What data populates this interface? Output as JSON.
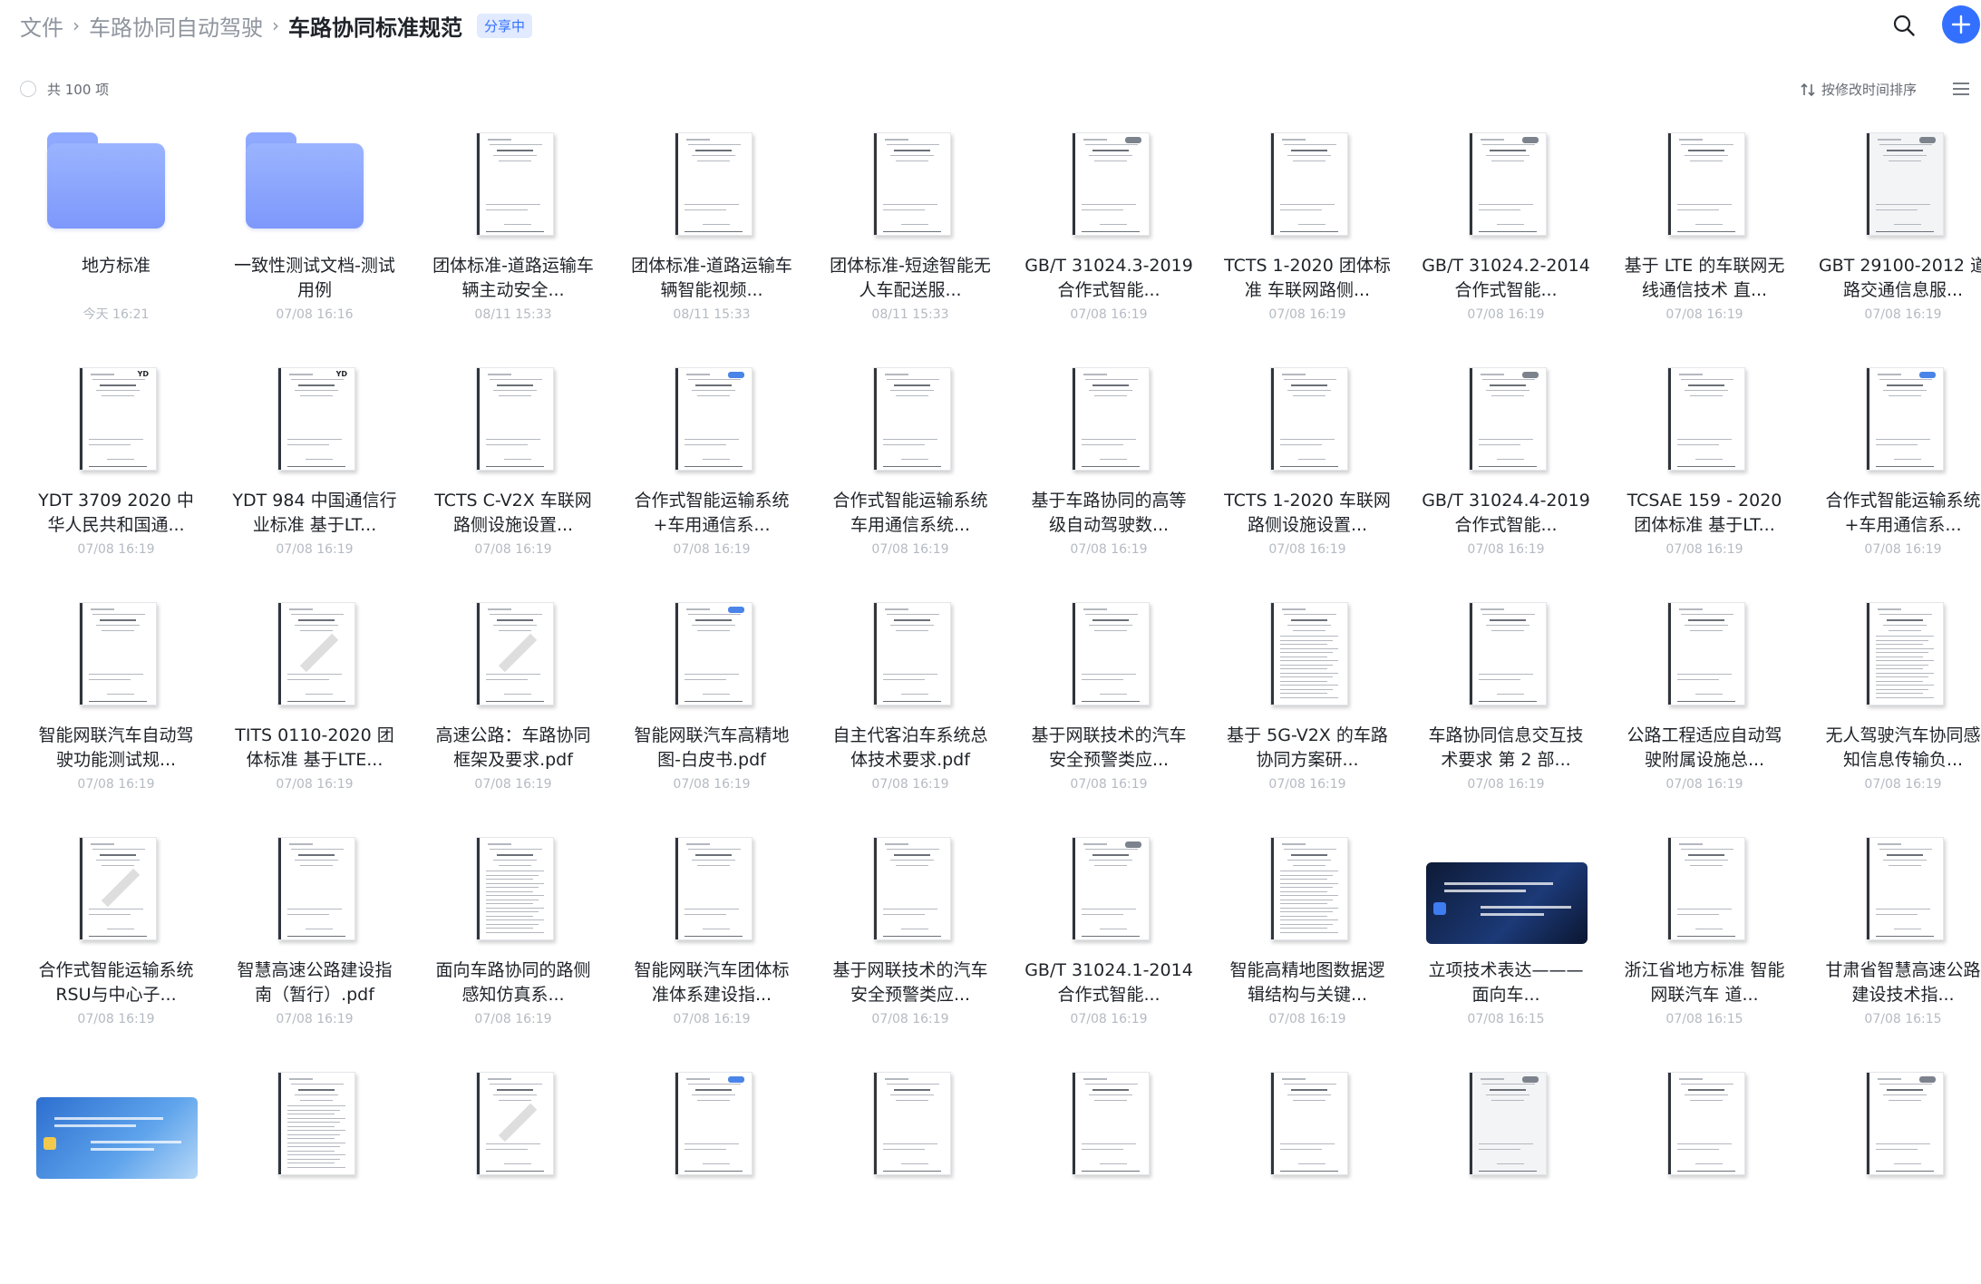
{
  "breadcrumb": {
    "root": "文件",
    "parent": "车路协同自动驾驶",
    "current": "车路协同标准规范",
    "badge": "分享中",
    "separator": "›"
  },
  "toolbar": {
    "search_icon": "search-icon",
    "add_icon": "plus-icon"
  },
  "list_header": {
    "count": "共 100 项",
    "sort_label": "按修改时间排序",
    "sort_icon": "sort-arrows-icon",
    "view_icon": "list-view-icon"
  },
  "colors": {
    "accent": "#3370ff",
    "folder": "#8ea9ff",
    "muted_text": "#8f959e"
  },
  "items": [
    {
      "kind": "folder",
      "title": "地方标准",
      "time": "今天 16:21"
    },
    {
      "kind": "folder",
      "title": "一致性测试文档-测试用例",
      "time": "07/08 16:16"
    },
    {
      "kind": "doc",
      "variant": "plain",
      "title": "团体标准-道路运输车辆主动安全...",
      "time": "08/11 15:33"
    },
    {
      "kind": "doc",
      "variant": "plain",
      "title": "团体标准-道路运输车辆智能视频...",
      "time": "08/11 15:33"
    },
    {
      "kind": "doc",
      "variant": "plain",
      "title": "团体标准-短途智能无人车配送服...",
      "time": "08/11 15:33"
    },
    {
      "kind": "doc",
      "variant": "gb",
      "title": "GB/T 31024.3-2019 合作式智能...",
      "time": "07/08 16:19"
    },
    {
      "kind": "doc",
      "variant": "plain",
      "title": "TCTS 1-2020 团体标准 车联网路侧...",
      "time": "07/08 16:19"
    },
    {
      "kind": "doc",
      "variant": "gb",
      "title": "GB/T 31024.2-2014 合作式智能...",
      "time": "07/08 16:19"
    },
    {
      "kind": "doc",
      "variant": "plain",
      "title": "基于 LTE 的车联网无线通信技术 直...",
      "time": "07/08 16:19"
    },
    {
      "kind": "doc",
      "variant": "grey",
      "title": "GBT 29100-2012 道路交通信息服...",
      "time": "07/08 16:19"
    },
    {
      "kind": "doc",
      "variant": "yd",
      "title": "YDT 3709 2020 中华人民共和国通...",
      "time": "07/08 16:19"
    },
    {
      "kind": "doc",
      "variant": "yd",
      "title": "YDT 984 中国通信行业标准 基于LT...",
      "time": "07/08 16:19"
    },
    {
      "kind": "doc",
      "variant": "plain",
      "title": "TCTS C-V2X 车联网路侧设施设置...",
      "time": "07/08 16:19"
    },
    {
      "kind": "doc",
      "variant": "blue",
      "title": "合作式智能运输系统+车用通信系...",
      "time": "07/08 16:19"
    },
    {
      "kind": "doc",
      "variant": "plain",
      "title": "合作式智能运输系统 车用通信系统...",
      "time": "07/08 16:19"
    },
    {
      "kind": "doc",
      "variant": "plain",
      "title": "基于车路协同的高等级自动驾驶数...",
      "time": "07/08 16:19"
    },
    {
      "kind": "doc",
      "variant": "plain",
      "title": "TCTS 1-2020 车联网路侧设施设置...",
      "time": "07/08 16:19"
    },
    {
      "kind": "doc",
      "variant": "gb",
      "title": "GB/T 31024.4-2019 合作式智能...",
      "time": "07/08 16:19"
    },
    {
      "kind": "doc",
      "variant": "plain",
      "title": "TCSAE 159 - 2020 团体标准 基于LT...",
      "time": "07/08 16:19"
    },
    {
      "kind": "doc",
      "variant": "blue",
      "title": "合作式智能运输系统+车用通信系...",
      "time": "07/08 16:19"
    },
    {
      "kind": "doc",
      "variant": "plain",
      "title": "智能网联汽车自动驾驶功能测试规...",
      "time": "07/08 16:19"
    },
    {
      "kind": "doc",
      "variant": "stamp",
      "title": "TITS 0110-2020 团体标准 基于LTE...",
      "time": "07/08 16:19"
    },
    {
      "kind": "doc",
      "variant": "stamp",
      "title": "高速公路：车路协同框架及要求.pdf",
      "time": "07/08 16:19"
    },
    {
      "kind": "doc",
      "variant": "blue",
      "title": "智能网联汽车高精地图-白皮书.pdf",
      "time": "07/08 16:19"
    },
    {
      "kind": "doc",
      "variant": "plain",
      "title": "自主代客泊车系统总体技术要求.pdf",
      "time": "07/08 16:19"
    },
    {
      "kind": "doc",
      "variant": "plain",
      "title": "基于网联技术的汽车安全预警类应...",
      "time": "07/08 16:19"
    },
    {
      "kind": "doc",
      "variant": "dense",
      "title": "基于 5G-V2X 的车路协同方案研...",
      "time": "07/08 16:19"
    },
    {
      "kind": "doc",
      "variant": "plain",
      "title": "车路协同信息交互技术要求 第 2 部...",
      "time": "07/08 16:19"
    },
    {
      "kind": "doc",
      "variant": "plain",
      "title": "公路工程适应自动驾驶附属设施总...",
      "time": "07/08 16:19"
    },
    {
      "kind": "doc",
      "variant": "dense",
      "title": "无人驾驶汽车协同感知信息传输负...",
      "time": "07/08 16:19"
    },
    {
      "kind": "doc",
      "variant": "stamp",
      "title": "合作式智能运输系统 RSU与中心子...",
      "time": "07/08 16:19"
    },
    {
      "kind": "doc",
      "variant": "plain",
      "title": "智慧高速公路建设指南（暂行）.pdf",
      "time": "07/08 16:19"
    },
    {
      "kind": "doc",
      "variant": "dense",
      "title": "面向车路协同的路侧感知仿真系...",
      "time": "07/08 16:19"
    },
    {
      "kind": "doc",
      "variant": "plain",
      "title": "智能网联汽车团体标准体系建设指...",
      "time": "07/08 16:19"
    },
    {
      "kind": "doc",
      "variant": "plain",
      "title": "基于网联技术的汽车安全预警类应...",
      "time": "07/08 16:19"
    },
    {
      "kind": "doc",
      "variant": "gb",
      "title": "GB/T 31024.1-2014 合作式智能...",
      "time": "07/08 16:19"
    },
    {
      "kind": "doc",
      "variant": "dense",
      "title": "智能高精地图数据逻辑结构与关键...",
      "time": "07/08 16:19"
    },
    {
      "kind": "media",
      "variant": "dark",
      "title": "立项技术表达———面向车...",
      "time": "07/08 16:15"
    },
    {
      "kind": "doc",
      "variant": "plain",
      "title": "浙江省地方标准 智能网联汽车 道...",
      "time": "07/08 16:15"
    },
    {
      "kind": "doc",
      "variant": "plain",
      "title": "甘肃省智慧高速公路建设技术指...",
      "time": "07/08 16:15"
    },
    {
      "kind": "media",
      "variant": "blue",
      "title": "",
      "time": ""
    },
    {
      "kind": "doc",
      "variant": "dense",
      "title": "",
      "time": ""
    },
    {
      "kind": "doc",
      "variant": "stamp",
      "title": "",
      "time": ""
    },
    {
      "kind": "doc",
      "variant": "blue",
      "title": "",
      "time": ""
    },
    {
      "kind": "doc",
      "variant": "plain",
      "title": "",
      "time": ""
    },
    {
      "kind": "doc",
      "variant": "plain",
      "title": "",
      "time": ""
    },
    {
      "kind": "doc",
      "variant": "plain",
      "title": "",
      "time": ""
    },
    {
      "kind": "doc",
      "variant": "grey",
      "title": "",
      "time": ""
    },
    {
      "kind": "doc",
      "variant": "plain",
      "title": "",
      "time": ""
    },
    {
      "kind": "doc",
      "variant": "gb",
      "title": "",
      "time": ""
    }
  ]
}
